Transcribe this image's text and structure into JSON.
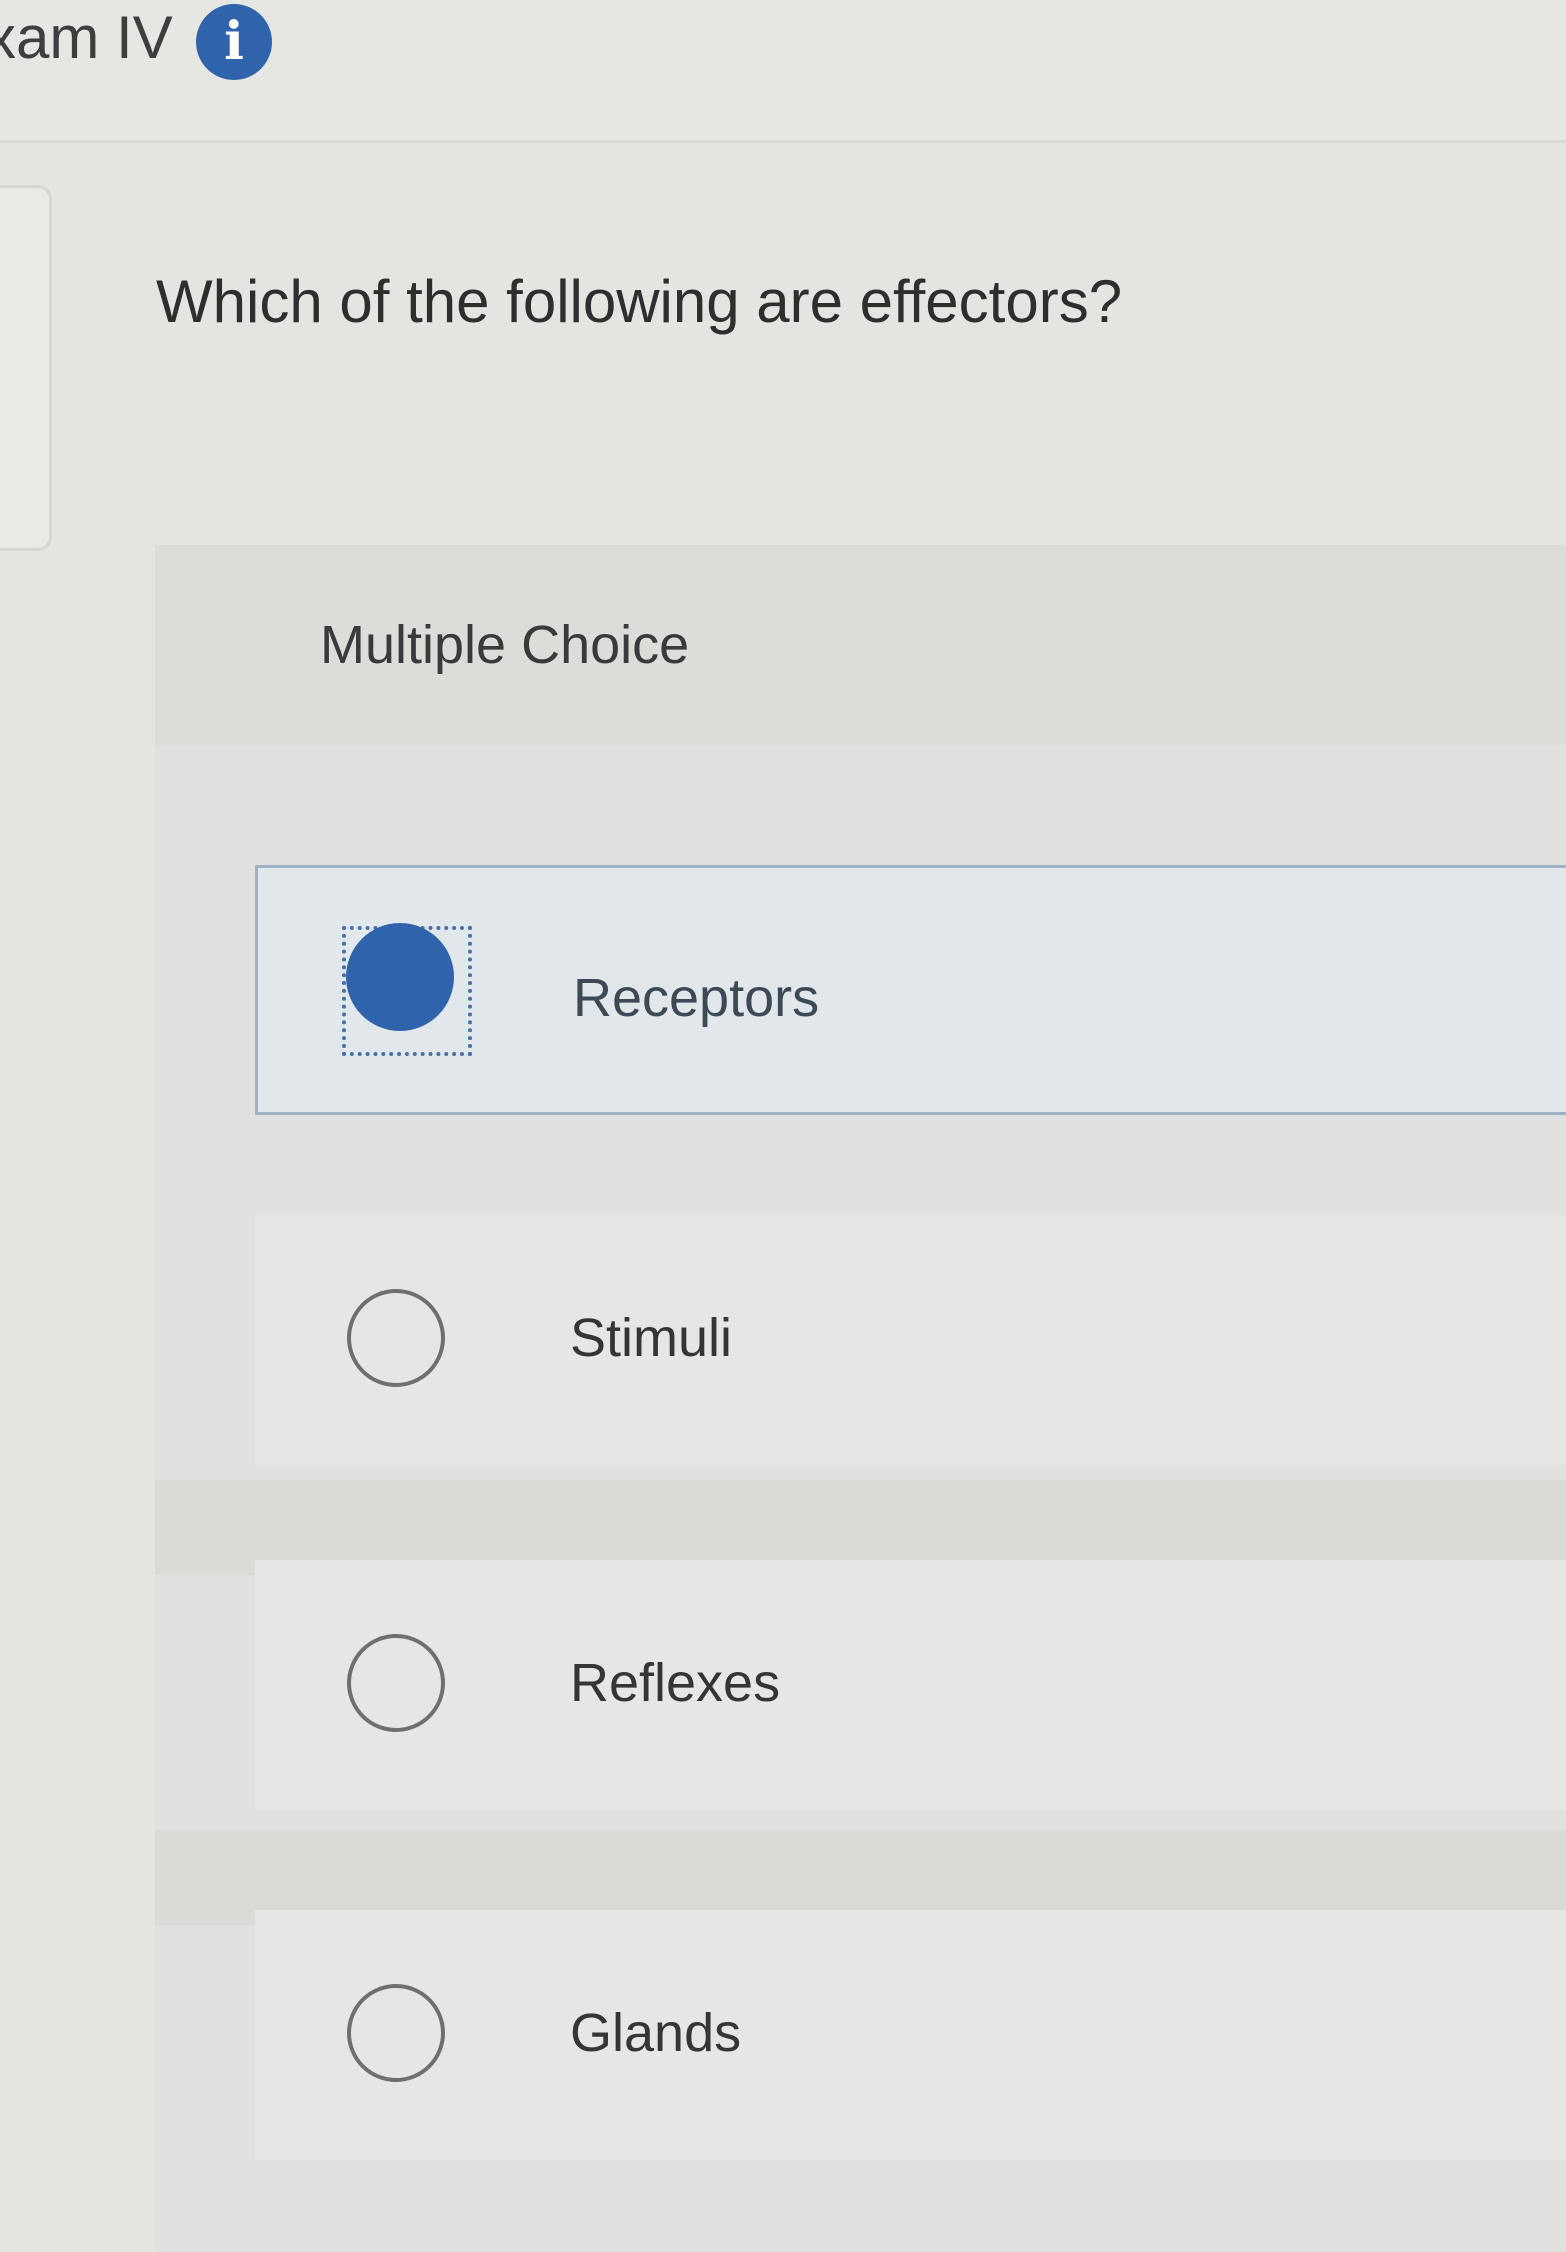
{
  "header": {
    "title": "xam IV",
    "info_icon": "info-icon"
  },
  "question": {
    "text": "Which of the following are effectors?",
    "type_label": "Multiple Choice"
  },
  "options": [
    {
      "label": "Receptors",
      "selected": true
    },
    {
      "label": "Stimuli",
      "selected": false
    },
    {
      "label": "Reflexes",
      "selected": false
    },
    {
      "label": "Glands",
      "selected": false
    }
  ],
  "colors": {
    "accent": "#2f64ad",
    "selected_bg": "#e1e7ea",
    "selected_border": "#9fb1c4"
  }
}
